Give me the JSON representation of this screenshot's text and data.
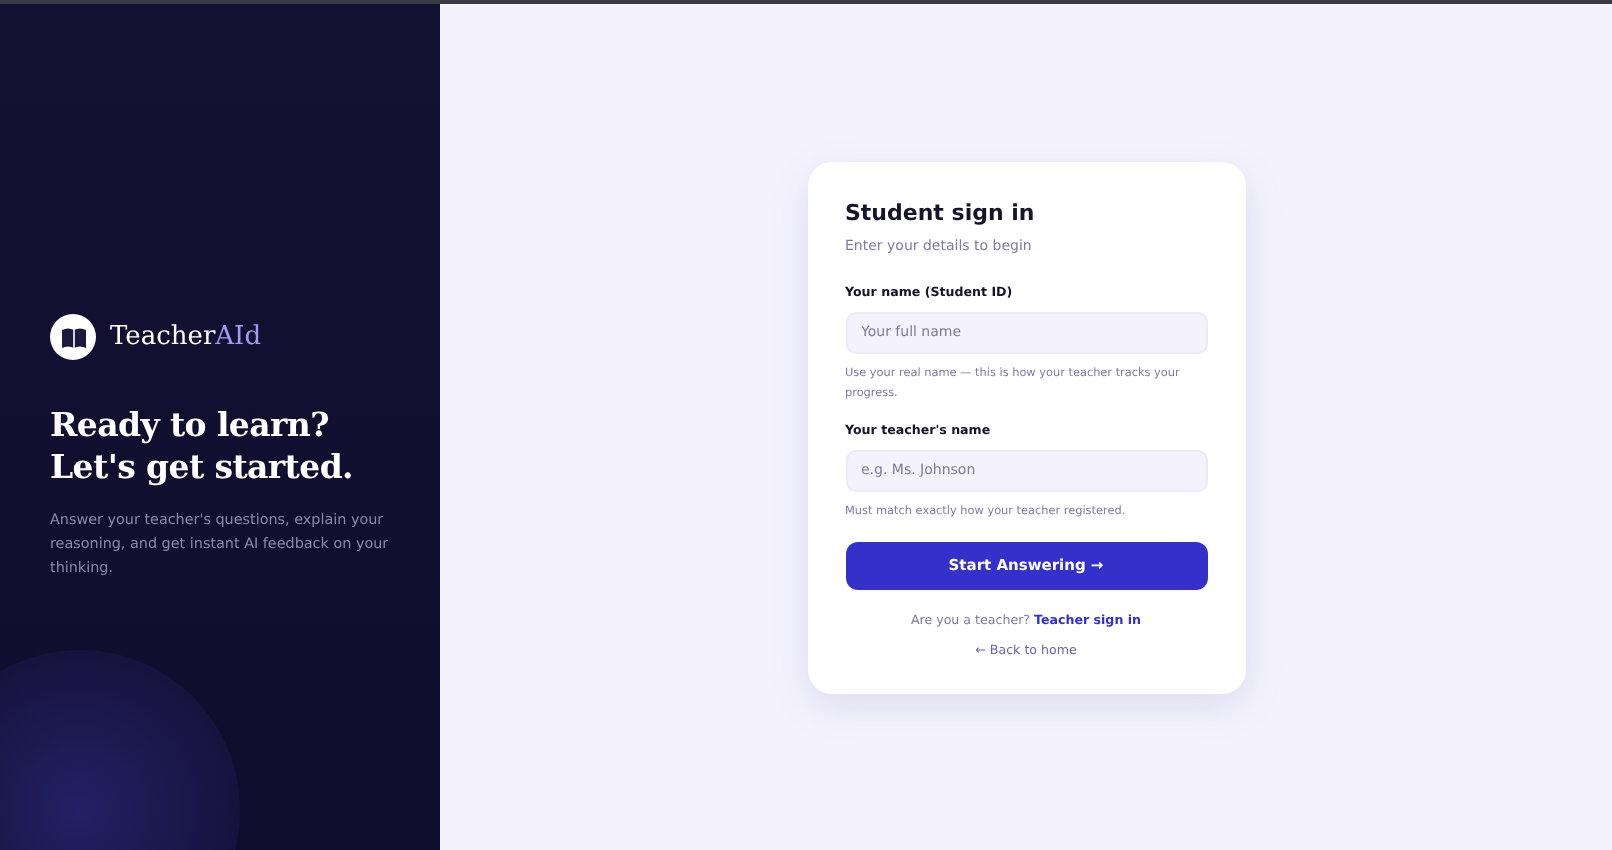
{
  "brand": {
    "name_start": "Teacher",
    "name_end": "AId"
  },
  "hero": {
    "headline_lines": [
      "Ready to learn?",
      "Let's get started."
    ],
    "description": "Answer your teacher's questions, explain your reasoning, and get instant AI feedback on your thinking."
  },
  "card": {
    "title": "Student sign in",
    "subtitle": "Enter your details to begin",
    "fields": [
      {
        "label": "Your name (Student ID)",
        "placeholder": "Your full name",
        "hint": "Use your real name — this is how your teacher tracks your progress."
      },
      {
        "label": "Your teacher's name",
        "placeholder": "e.g. Ms. Johnson",
        "hint": "Must match exactly how your teacher registered."
      }
    ],
    "submit": "Start Answering →",
    "teacher_prompt": "Are you a teacher?",
    "teacher_link": "Teacher sign in",
    "back_link": "← Back to home"
  }
}
